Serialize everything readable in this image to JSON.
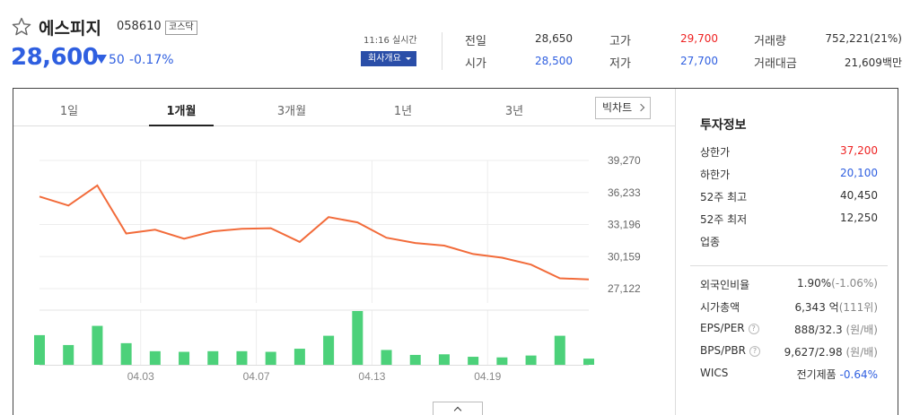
{
  "stock": {
    "name": "에스피지",
    "code": "058610",
    "market": "코스닥",
    "price": "28,600",
    "change": "50",
    "change_pct": "-0.17%",
    "realtime": "11:16 실시간",
    "company_btn": "회사개요"
  },
  "quote": {
    "prev_close_label": "전일",
    "prev_close": "28,650",
    "open_label": "시가",
    "open": "28,500",
    "high_label": "고가",
    "high": "29,700",
    "low_label": "저가",
    "low": "27,700",
    "volume_label": "거래량",
    "volume": "752,221(21%)",
    "amount_label": "거래대금",
    "amount": "21,609백만"
  },
  "tabs": [
    {
      "label": "1일"
    },
    {
      "label": "1개월",
      "active": true
    },
    {
      "label": "3개월"
    },
    {
      "label": "1년"
    },
    {
      "label": "3년"
    }
  ],
  "bigchart_label": "빅차트",
  "chart_data": {
    "type": "line",
    "y_ticks": [
      "39,270",
      "36,233",
      "33,196",
      "30,159",
      "27,122"
    ],
    "ylim": [
      27122,
      39270
    ],
    "x_labels": [
      "04.03",
      "04.07",
      "04.13",
      "04.19"
    ],
    "price": [
      35850,
      35000,
      36900,
      32350,
      32700,
      31850,
      32550,
      32800,
      32850,
      31550,
      33900,
      33400,
      31950,
      31450,
      31200,
      30400,
      30050,
      29400,
      28100,
      28000
    ],
    "volume": [
      48,
      32,
      63,
      35,
      22,
      21,
      22,
      22,
      21,
      26,
      47,
      87,
      24,
      16,
      17,
      13,
      12,
      15,
      47,
      10
    ],
    "line_color": "#f26b3a",
    "bar_color": "#4cd17a",
    "grid": true
  },
  "invest": {
    "title": "투자정보",
    "items": [
      {
        "label": "상한가",
        "value": "37,200",
        "color": "red"
      },
      {
        "label": "하한가",
        "value": "20,100",
        "color": "blue"
      },
      {
        "label": "52주 최고",
        "value": "40,450"
      },
      {
        "label": "52주 최저",
        "value": "12,250"
      },
      {
        "label": "업종",
        "value": ""
      }
    ],
    "items2": [
      {
        "label": "외국인비율",
        "value": "1.90%",
        "sub": "(-1.06%)"
      },
      {
        "label": "시가총액",
        "value": "6,343 억",
        "sub": "(111위)"
      },
      {
        "label": "EPS/PER",
        "value": "888/32.3",
        "sub": " (원/배)",
        "help": "?"
      },
      {
        "label": "BPS/PBR",
        "value": "9,627/2.98",
        "sub": " (원/배)",
        "help": "?"
      },
      {
        "label": "WICS",
        "value": "전기제품",
        "sub": " -0.64%"
      }
    ]
  }
}
